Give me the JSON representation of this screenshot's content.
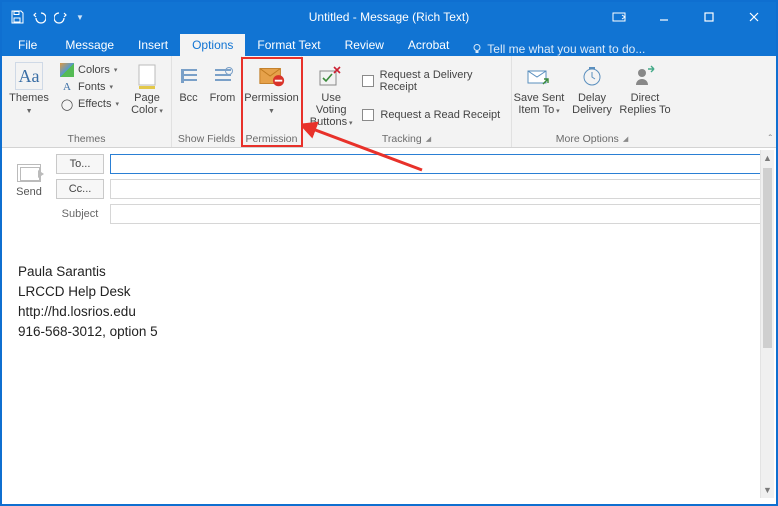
{
  "titlebar": {
    "title": "Untitled - Message (Rich Text)"
  },
  "tabs": {
    "file": "File",
    "message": "Message",
    "insert": "Insert",
    "options": "Options",
    "format_text": "Format Text",
    "review": "Review",
    "acrobat": "Acrobat",
    "tellme": "Tell me what you want to do..."
  },
  "ribbon": {
    "themes": {
      "group_label": "Themes",
      "themes": "Themes",
      "colors": "Colors",
      "fonts": "Fonts",
      "effects": "Effects",
      "page_color": "Page Color"
    },
    "show_fields": {
      "group_label": "Show Fields",
      "bcc": "Bcc",
      "from": "From"
    },
    "permission": {
      "group_label": "Permission",
      "permission": "Permission"
    },
    "tracking": {
      "group_label": "Tracking",
      "use_voting": "Use Voting Buttons",
      "delivery_receipt": "Request a Delivery Receipt",
      "read_receipt": "Request a Read Receipt"
    },
    "more_options": {
      "group_label": "More Options",
      "save_sent": "Save Sent Item To",
      "delay": "Delay Delivery",
      "direct": "Direct Replies To"
    }
  },
  "compose": {
    "send": "Send",
    "to": "To...",
    "cc": "Cc...",
    "subject_label": "Subject",
    "to_value": "",
    "cc_value": "",
    "subject_value": ""
  },
  "signature": {
    "line1": "Paula Sarantis",
    "line2": "LRCCD Help Desk",
    "line3": "http://hd.losrios.edu",
    "line4": "916-568-3012, option 5"
  }
}
